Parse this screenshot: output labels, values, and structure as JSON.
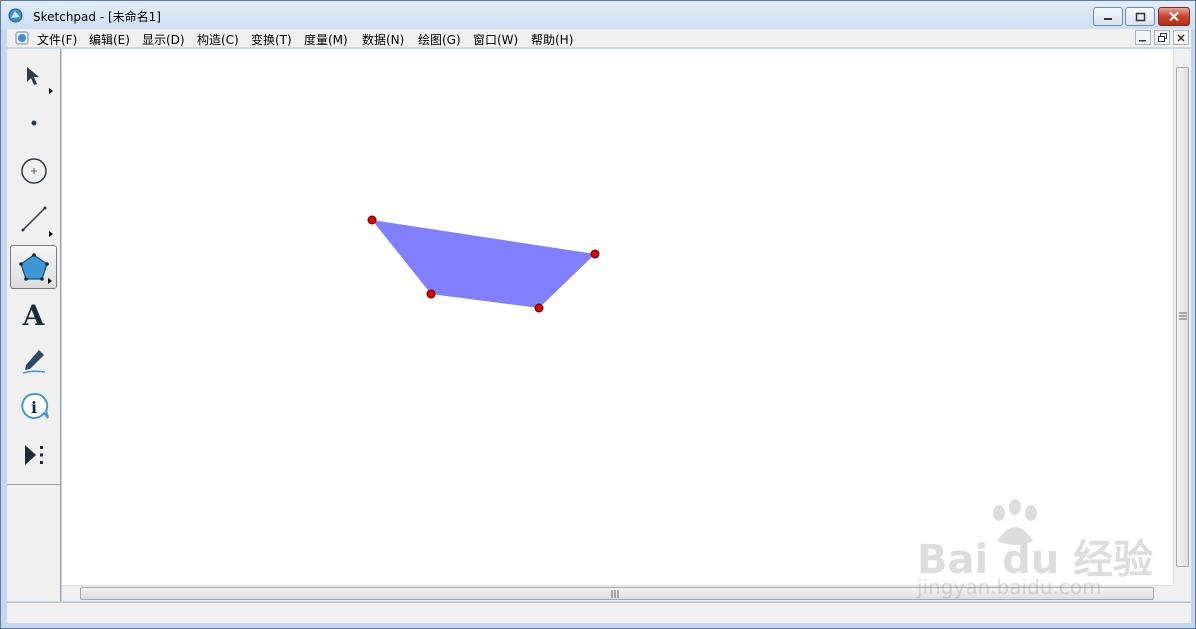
{
  "window": {
    "title": "Sketchpad  - [未命名1]"
  },
  "menu": {
    "items": [
      "文件(F)",
      "编辑(E)",
      "显示(D)",
      "构造(C)",
      "变换(T)",
      "度量(M)",
      "数据(N)",
      "绘图(G)",
      "窗口(W)",
      "帮助(H)"
    ]
  },
  "toolbox": {
    "tools": [
      {
        "name": "arrow-tool",
        "icon": "arrow-icon",
        "active": false
      },
      {
        "name": "point-tool",
        "icon": "point-icon",
        "active": false
      },
      {
        "name": "compass-tool",
        "icon": "circle-icon",
        "active": false
      },
      {
        "name": "straightedge-tool",
        "icon": "segment-icon",
        "active": false
      },
      {
        "name": "polygon-tool",
        "icon": "polygon-icon",
        "active": true
      },
      {
        "name": "text-tool",
        "icon": "text-icon",
        "active": false
      },
      {
        "name": "marker-tool",
        "icon": "marker-icon",
        "active": false
      },
      {
        "name": "information-tool",
        "icon": "info-icon",
        "active": false
      },
      {
        "name": "custom-tool",
        "icon": "custom-tool-icon",
        "active": false
      }
    ],
    "text_tool_label": "A"
  },
  "sketch": {
    "polygon_fill": "#8080ff",
    "point_fill": "#e00000"
  },
  "watermark": {
    "line1": "Bai du 经验",
    "line2": "jingyan.baidu.com"
  }
}
